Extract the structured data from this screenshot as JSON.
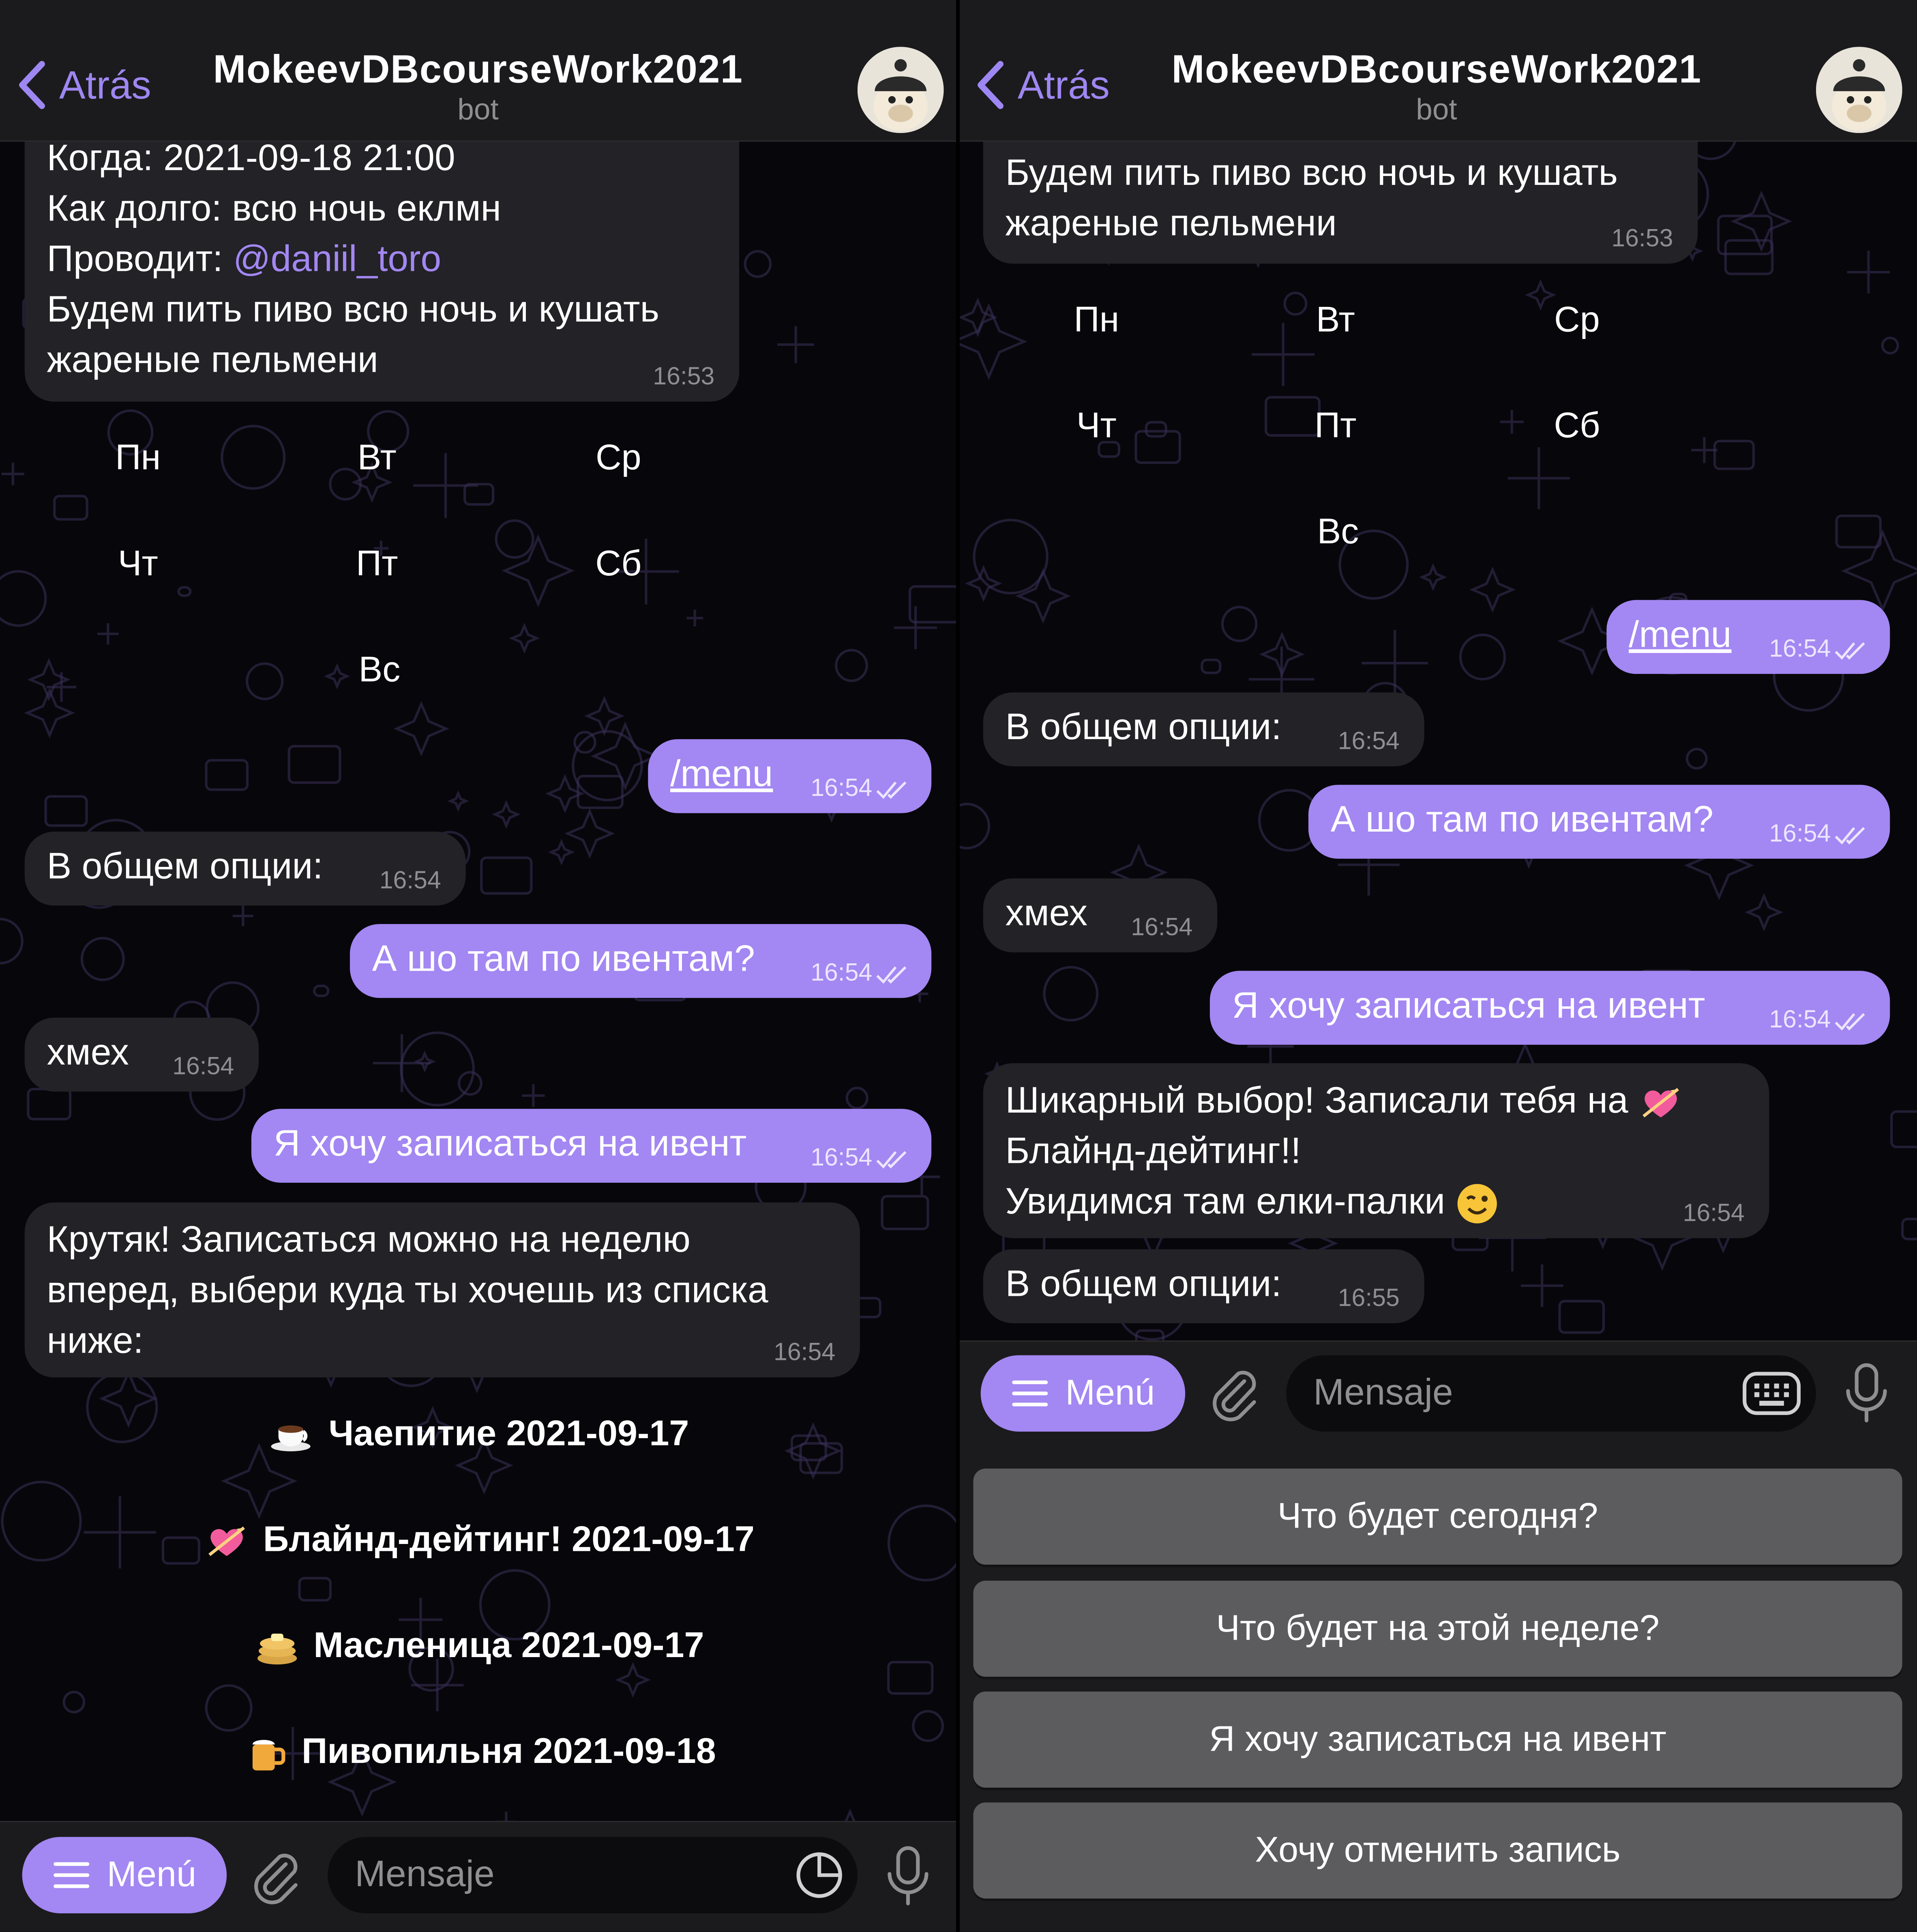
{
  "left": {
    "header": {
      "back_label": "Atrás",
      "title": "MokeevDBcourseWork2021",
      "subtitle": "bot"
    },
    "event_lines": [
      "Когда: 2021-09-18 21:00",
      "Как долго: всю ночь еклмн",
      "Проводит: ",
      "Будем пить пиво всю ночь и кушать",
      "жареные пельмени"
    ],
    "organizer": "@daniil_toro",
    "event_time": "16:53",
    "weekdays": [
      "Пн",
      "Вт",
      "Ср",
      "Чт",
      "Пт",
      "Сб",
      "Вс"
    ],
    "messages": [
      {
        "text": "/menu",
        "time": "16:54"
      },
      {
        "text": "В общем опции:",
        "time": "16:54"
      },
      {
        "text": "А шо там по ивентам?",
        "time": "16:54"
      },
      {
        "text": "хмех",
        "time": "16:54"
      },
      {
        "text": "Я хочу записаться на ивент",
        "time": "16:54"
      },
      {
        "text": "Крутяк! Записаться можно на неделю\nвперед, выбери куда ты хочешь из списка\nниже:",
        "time": "16:54"
      }
    ],
    "events": [
      {
        "icon": "coffee-cup-icon",
        "label": "Чаепитие 2021-09-17"
      },
      {
        "icon": "heart-arrow-icon",
        "label": "Блайнд-дейтинг! 2021-09-17"
      },
      {
        "icon": "pancakes-icon",
        "label": "Масленица 2021-09-17"
      },
      {
        "icon": "beer-mug-icon",
        "label": "Пивопильня 2021-09-18"
      }
    ],
    "input": {
      "menu_label": "Menú",
      "placeholder": "Mensaje"
    }
  },
  "right": {
    "header": {
      "back_label": "Atrás",
      "title": "MokeevDBcourseWork2021",
      "subtitle": "bot"
    },
    "event_lines": [
      "Будем пить пиво всю ночь и кушать",
      "жареные пельмени"
    ],
    "event_time": "16:53",
    "weekdays": [
      "Пн",
      "Вт",
      "Ср",
      "Чт",
      "Пт",
      "Сб",
      "Вс"
    ],
    "messages": [
      {
        "text": "/menu",
        "time": "16:54"
      },
      {
        "text": "В общем опции:",
        "time": "16:54"
      },
      {
        "text": "А шо там по ивентам?",
        "time": "16:54"
      },
      {
        "text": "хмех",
        "time": "16:54"
      },
      {
        "text": "Я хочу записаться на ивент",
        "time": "16:54"
      },
      {
        "lines": [
          "Шикарный выбор! Записали тебя на",
          "Блайнд-дейтинг!!",
          "Увидимся там елки-палки"
        ],
        "time": "16:54"
      },
      {
        "text": "В общем опции:",
        "time": "16:55"
      }
    ],
    "input": {
      "menu_label": "Menú",
      "placeholder": "Mensaje"
    },
    "reply_keyboard": [
      "Что будет сегодня?",
      "Что будет на этой неделе?",
      "Я хочу записаться на ивент",
      "Хочу отменить запись"
    ]
  },
  "colors": {
    "accent": "#a387f2",
    "incoming_bubble": "#222227",
    "bar": "#1b1b1d",
    "keyboard_button": "#5c5c5f"
  }
}
